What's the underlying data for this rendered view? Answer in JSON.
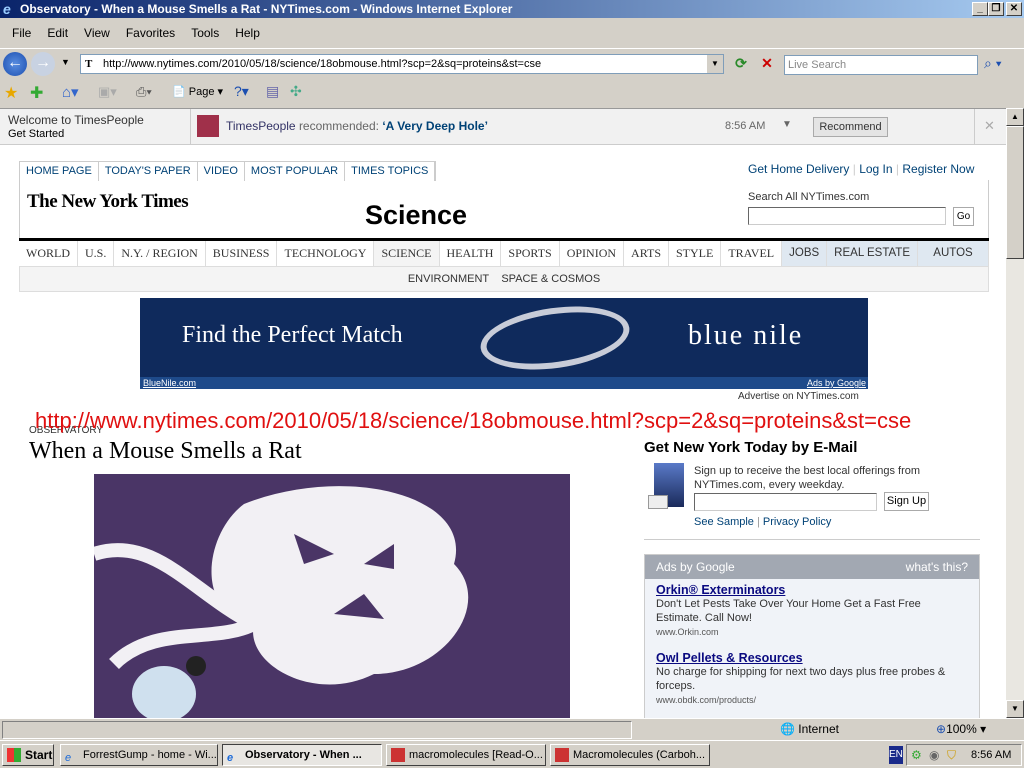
{
  "window": {
    "title": "Observatory - When a Mouse Smells a Rat - NYTimes.com - Windows Internet Explorer"
  },
  "menu": [
    "File",
    "Edit",
    "View",
    "Favorites",
    "Tools",
    "Help"
  ],
  "address": {
    "url": "http://www.nytimes.com/2010/05/18/science/18obmouse.html?scp=2&sq=proteins&st=cse",
    "search_placeholder": "Live Search"
  },
  "toolbar": {
    "page_label": "Page"
  },
  "timespeople": {
    "welcome": "Welcome to TimesPeople",
    "get_started": "Get Started",
    "source": "TimesPeople",
    "recommended": "recommended:",
    "headline": "‘A Very Deep Hole’",
    "time": "8:56 AM",
    "button": "Recommend"
  },
  "nyt": {
    "top_tabs": [
      "HOME PAGE",
      "TODAY'S PAPER",
      "VIDEO",
      "MOST POPULAR",
      "TIMES TOPICS"
    ],
    "account_links": [
      "Get Home Delivery",
      "Log In",
      "Register Now"
    ],
    "logo": "The New York Times",
    "section_title": "Science",
    "search_label": "Search All NYTimes.com",
    "search_go": "Go",
    "sections": [
      "WORLD",
      "U.S.",
      "N.Y. / REGION",
      "BUSINESS",
      "TECHNOLOGY",
      "SCIENCE",
      "HEALTH",
      "SPORTS",
      "OPINION",
      "ARTS",
      "STYLE",
      "TRAVEL"
    ],
    "blue_sections": [
      "JOBS",
      "REAL ESTATE",
      "AUTOS"
    ],
    "subsections": [
      "ENVIRONMENT",
      "SPACE & COSMOS"
    ],
    "ad": {
      "tagline": "Find the Perfect Match",
      "brand": "blue nile",
      "site": "BlueNile.com",
      "ads_by": "Ads by Google",
      "advertise": "Advertise on NYTimes.com"
    },
    "overlay_url": "http://www.nytimes.com/2010/05/18/science/18obmouse.html?scp=2&sq=proteins&st=cse",
    "kicker": "OBSERVATORY",
    "headline": "When a Mouse Smells a Rat",
    "email": {
      "title": "Get New York Today by E-Mail",
      "text": "Sign up to receive the best local offerings from NYTimes.com, every weekday.",
      "button": "Sign Up",
      "see_sample": "See Sample",
      "privacy": "Privacy Policy"
    },
    "google_ads": {
      "header": "Ads by Google",
      "whats_this": "what's this?",
      "items": [
        {
          "title": "Orkin® Exterminators",
          "text": "Don't Let Pests Take Over Your Home Get a Fast Free Estimate. Call Now!",
          "url": "www.Orkin.com"
        },
        {
          "title": "Owl Pellets & Resources",
          "text": "No charge for shipping for next two days plus free probes & forceps.",
          "url": "www.obdk.com/products/"
        }
      ]
    }
  },
  "status": {
    "zone": "Internet",
    "zoom": "100%"
  },
  "taskbar": {
    "start": "Start",
    "items": [
      "ForrestGump - home - Wi...",
      "Observatory - When ...",
      "macromolecules [Read-O...",
      "Macromolecules (Carboh..."
    ],
    "lang": "EN",
    "clock": "8:56 AM"
  }
}
